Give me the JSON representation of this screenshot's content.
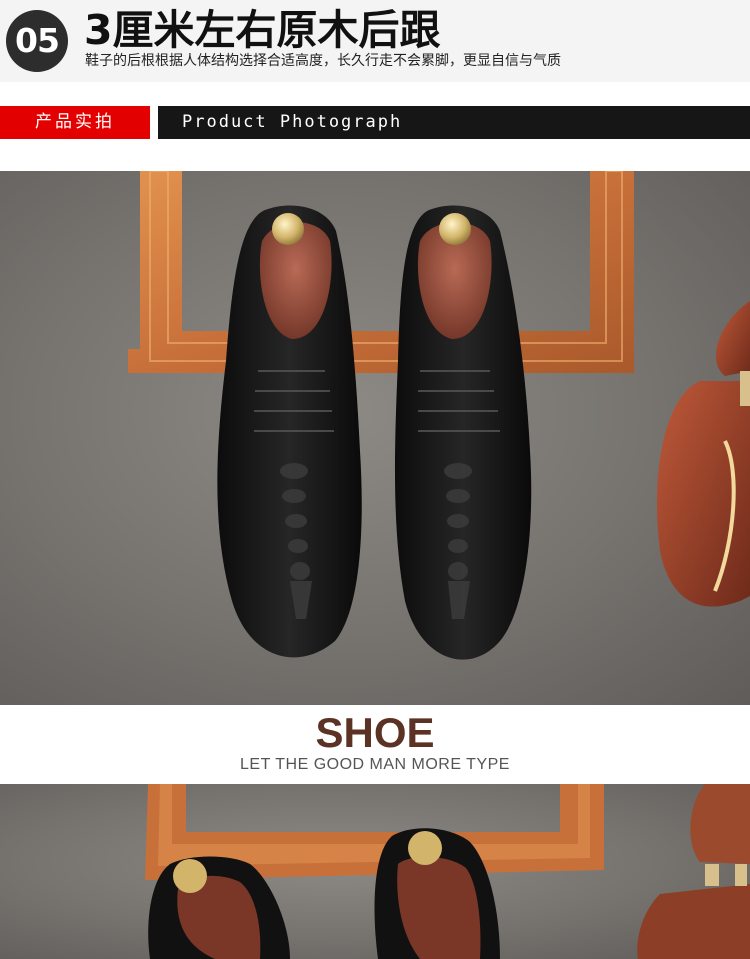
{
  "feature": {
    "number": "05",
    "title": "3厘米左右原木后跟",
    "description": "鞋子的后根根据人体结构选择合适高度，长久行走不会累脚，更显自信与气质"
  },
  "section": {
    "label_cn": "产品实拍",
    "label_en": "Product Photograph"
  },
  "brand": {
    "title": "SHOE",
    "tagline": "LET THE GOOD MAN MORE TYPE"
  },
  "colors": {
    "accent_red": "#e30000",
    "bar_black": "#161616",
    "brand_brown": "#5b3223"
  },
  "images": [
    {
      "name": "main-product-photo",
      "depicts": "pair of black crocodile-embossed oxford shoes with wooden shoe trees on a wooden frame"
    },
    {
      "name": "secondary-product-photo",
      "depicts": "same shoes viewed from above, partially shown"
    }
  ]
}
